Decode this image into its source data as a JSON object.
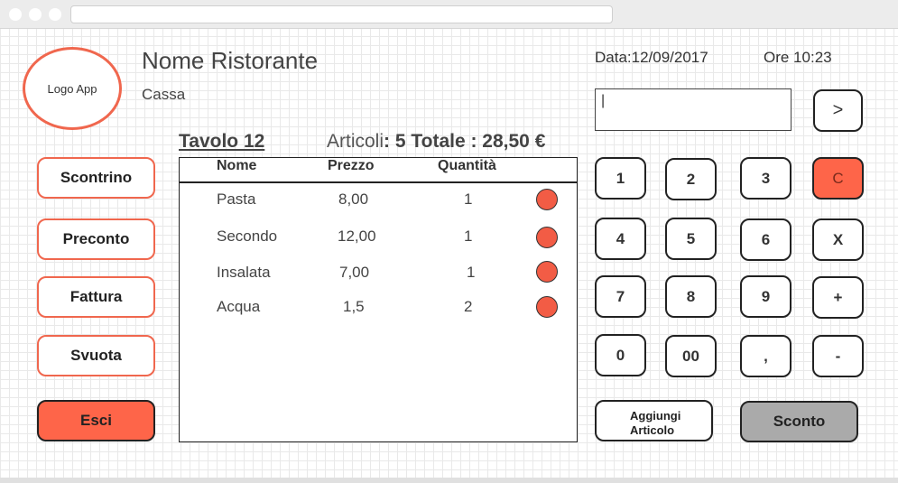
{
  "header": {
    "logo_text": "Logo App",
    "restaurant_name": "Nome Ristorante",
    "subtitle": "Cassa",
    "date": "Data:12/09/2017",
    "time": "Ore 10:23"
  },
  "display": {
    "value": "|",
    "go_label": ">"
  },
  "order": {
    "table_label": "Tavolo 12",
    "articles_label": "Articoli",
    "articles_count": ": 5 Totale",
    "total": ": 28,50 €"
  },
  "sidebar": {
    "buttons": [
      "Scontrino",
      "Preconto",
      "Fattura",
      "Svuota"
    ],
    "exit_label": "Esci"
  },
  "items_table": {
    "columns": [
      "Nome",
      "Prezzo",
      "Quantità"
    ],
    "rows": [
      {
        "name": "Pasta",
        "price": "8,00",
        "qty": "1"
      },
      {
        "name": "Secondo",
        "price": "12,00",
        "qty": "1"
      },
      {
        "name": "Insalata",
        "price": "7,00",
        "qty": "1"
      },
      {
        "name": "Acqua",
        "price": "1,5",
        "qty": "2"
      }
    ]
  },
  "keypad": {
    "keys": [
      "1",
      "2",
      "3",
      "C",
      "4",
      "5",
      "6",
      "X",
      "7",
      "8",
      "9",
      "+",
      "0",
      "00",
      ",",
      "-"
    ]
  },
  "actions": {
    "add_line1": "Aggiungi",
    "add_line2": "Articolo",
    "discount_label": "Sconto"
  },
  "colors": {
    "accent": "#f0674e",
    "danger_fill": "#fe6549",
    "discount_fill": "#aaaaaa"
  }
}
